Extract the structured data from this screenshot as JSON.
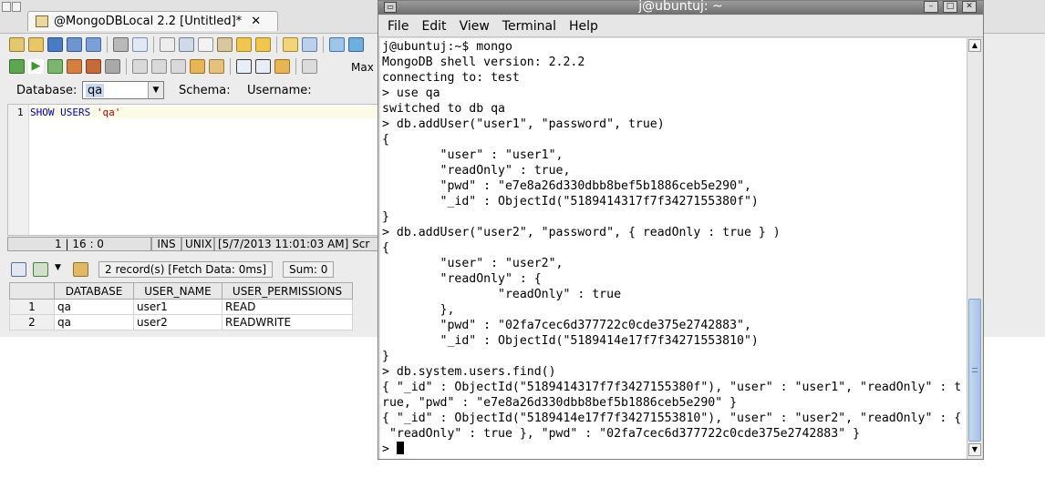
{
  "ide": {
    "tab_title": "@MongoDBLocal 2.2 [Untitled]*",
    "tab_close": "✕",
    "toolbar_max_label": "Max",
    "database_label": "Database:",
    "database_value": "qa",
    "schema_label": "Schema:",
    "username_label": "Username:",
    "editor": {
      "line_number": "1",
      "code_keyword": "SHOW USERS",
      "code_string": "'qa'"
    },
    "status": {
      "position": "1 | 16 : 0",
      "insert_mode": "INS",
      "line_ending": "UNIX",
      "timestamp": "[5/7/2013 11:01:03 AM] Scr"
    },
    "results": {
      "info": "2 record(s) [Fetch Data: 0ms]",
      "sum": "Sum: 0",
      "columns": [
        "DATABASE",
        "USER_NAME",
        "USER_PERMISSIONS"
      ],
      "rows": [
        {
          "num": "1",
          "database": "qa",
          "user_name": "user1",
          "permissions": "READ"
        },
        {
          "num": "2",
          "database": "qa",
          "user_name": "user2",
          "permissions": "READWRITE"
        }
      ]
    }
  },
  "terminal": {
    "title": "j@ubuntuj: ~",
    "menu": [
      "File",
      "Edit",
      "View",
      "Terminal",
      "Help"
    ],
    "lines": [
      "j@ubuntuj:~$ mongo",
      "MongoDB shell version: 2.2.2",
      "connecting to: test",
      "> use qa",
      "switched to db qa",
      "> db.addUser(\"user1\", \"password\", true)",
      "{",
      "        \"user\" : \"user1\",",
      "        \"readOnly\" : true,",
      "        \"pwd\" : \"e7e8a26d330dbb8bef5b1886ceb5e290\",",
      "        \"_id\" : ObjectId(\"5189414317f7f3427155380f\")",
      "}",
      "> db.addUser(\"user2\", \"password\", { readOnly : true } )",
      "{",
      "        \"user\" : \"user2\",",
      "        \"readOnly\" : {",
      "                \"readOnly\" : true",
      "        },",
      "        \"pwd\" : \"02fa7cec6d377722c0cde375e2742883\",",
      "        \"_id\" : ObjectId(\"5189414e17f7f34271553810\")",
      "}",
      "> db.system.users.find()",
      "{ \"_id\" : ObjectId(\"5189414317f7f3427155380f\"), \"user\" : \"user1\", \"readOnly\" : t",
      "rue, \"pwd\" : \"e7e8a26d330dbb8bef5b1886ceb5e290\" }",
      "{ \"_id\" : ObjectId(\"5189414e17f7f34271553810\"), \"user\" : \"user2\", \"readOnly\" : {",
      " \"readOnly\" : true }, \"pwd\" : \"02fa7cec6d377722c0cde375e2742883\" }"
    ],
    "prompt": "> "
  },
  "colors": {
    "terminal_titlebar": "#7e7e7e",
    "scroll_thumb": "#b8cdea",
    "keyword": "#0000c0",
    "string": "#c00000"
  }
}
